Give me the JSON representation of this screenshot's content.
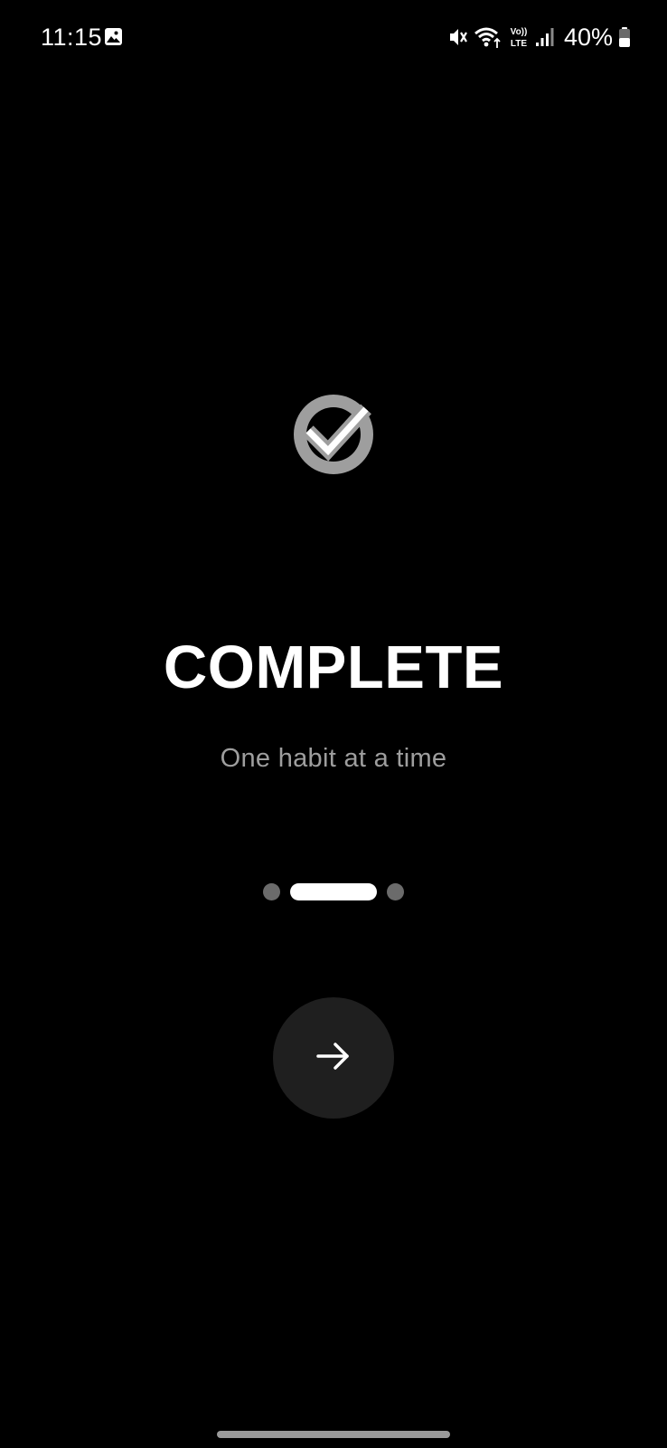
{
  "status_bar": {
    "time": "11:15",
    "gallery_icon": "image-icon",
    "mute_icon": "vibrate-mute-icon",
    "wifi_icon": "wifi-icon",
    "volte_label": "Vo)) LTE",
    "signal_icon": "signal-icon",
    "battery_percent": "40%",
    "battery_level": 0.4,
    "battery_icon": "battery-icon"
  },
  "splash": {
    "logo_icon": "check-circle-icon",
    "title": "COMPLETE",
    "tagline": "One habit at a time"
  },
  "pager": {
    "pages": 3,
    "active_index": 1
  },
  "next_button": {
    "icon": "arrow-right-icon"
  },
  "colors": {
    "background": "#000000",
    "logo_circle": "#9e9e9e",
    "tagline": "#9e9e9e",
    "dot_inactive": "#6b6b6b",
    "dot_active": "#ffffff",
    "button_bg": "#1f1f1f"
  }
}
